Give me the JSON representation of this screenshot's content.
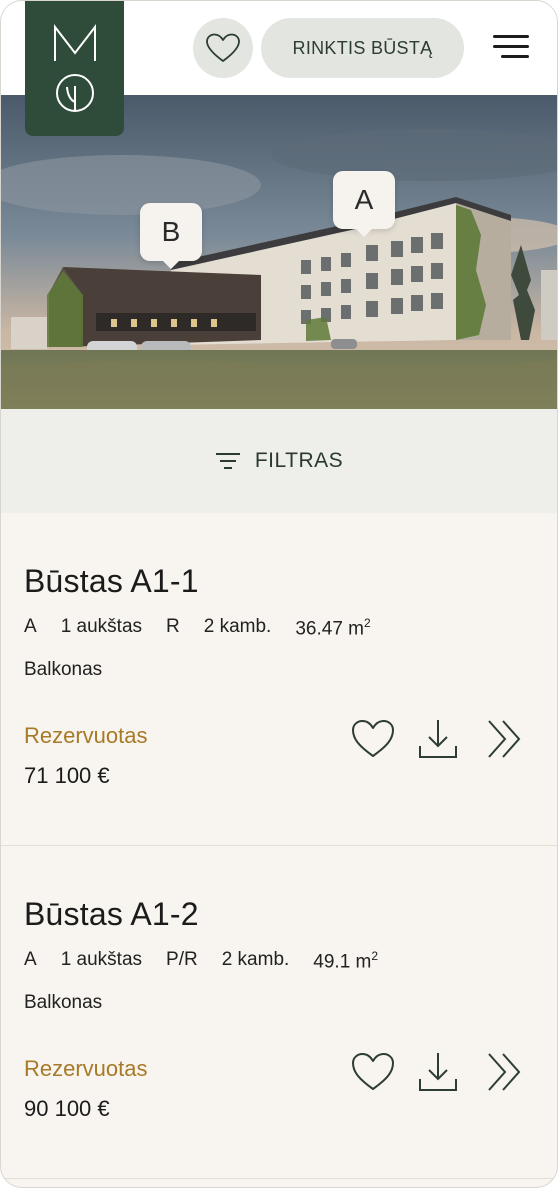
{
  "header": {
    "logo_letter": "M",
    "favorites_icon": "heart-icon",
    "choose_button_label": "RINKTIS BŪSTĄ",
    "menu_icon": "hamburger-menu-icon"
  },
  "hero": {
    "pins": [
      {
        "label": "B"
      },
      {
        "label": "A"
      }
    ]
  },
  "filter": {
    "label": "FILTRAS",
    "icon": "filter-icon"
  },
  "listings": [
    {
      "title": "Būstas A1-1",
      "building": "A",
      "floor": "1 aukštas",
      "orientation": "R",
      "rooms": "2 kamb.",
      "area": "36.47 m",
      "area_unit_sup": "2",
      "feature": "Balkonas",
      "status": "Rezervuotas",
      "price": "71 100 €"
    },
    {
      "title": "Būstas A1-2",
      "building": "A",
      "floor": "1 aukštas",
      "orientation": "P/R",
      "rooms": "2 kamb.",
      "area": "49.1 m",
      "area_unit_sup": "2",
      "feature": "Balkonas",
      "status": "Rezervuotas",
      "price": "90 100 €"
    }
  ],
  "colors": {
    "brand_green": "#2f4c3b",
    "status_gold": "#a67a26",
    "page_bg": "#f8f4ef"
  }
}
